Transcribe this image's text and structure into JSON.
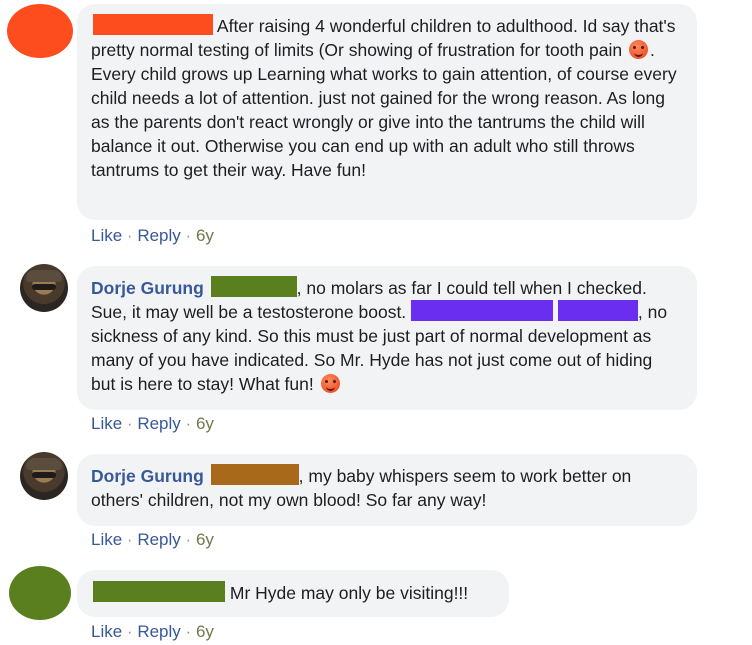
{
  "comments": [
    {
      "author": "",
      "redact_color": "#fd4d1e",
      "text": "After raising 4 wonderful children to adulthood. Id say that's pretty normal testing of limits (Or showing of frustration for tooth pain",
      "text_after_emoji": ". Every child grows up Learning what works to gain attention, of course every child needs a lot of attention. just not gained for the wrong reason. As long as the parents don't react wrongly or give into the tantrums the child will balance it out. Otherwise you can end up with an adult who still throws tantrums to get their way. Have fun!",
      "emoji": "smiley-emoji",
      "actions": {
        "like": "Like",
        "reply": "Reply",
        "sep": "·",
        "time": "6y"
      }
    },
    {
      "author": "Dorje Gurung",
      "redact_color": "#5a7f1f",
      "text": ", no molars as far I could tell when I checked. Sue, it may well be a testosterone boost.",
      "redact2_color": "#6a2ef0",
      "text2": ", no sickness of any kind. So this must be just part of normal development as many of you have indicated. So Mr. Hyde has not just come out of hiding but is here to stay! What fun!",
      "emoji": "tongue-emoji",
      "actions": {
        "like": "Like",
        "reply": "Reply",
        "sep": "·",
        "time": "6y"
      }
    },
    {
      "author": "Dorje Gurung",
      "redact_color": "#a9691b",
      "text": ", my baby whispers seem to work better on others' children, not my own blood! So far any way!",
      "actions": {
        "like": "Like",
        "reply": "Reply",
        "sep": "·",
        "time": "6y"
      }
    },
    {
      "author": "",
      "redact_color": "#5a7f1f",
      "text": "Mr Hyde may only be visiting!!!",
      "actions": {
        "like": "Like",
        "reply": "Reply",
        "sep": "·",
        "time": "6y"
      }
    }
  ]
}
